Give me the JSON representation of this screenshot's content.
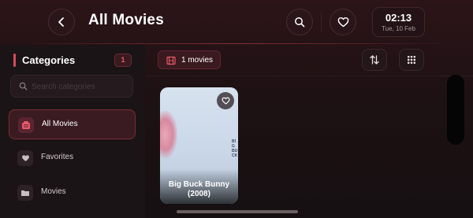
{
  "header": {
    "title": "All Movies",
    "time": "02:13",
    "date": "Tue, 10 Feb",
    "icons": {
      "back": "back-arrow-icon",
      "search": "search-icon",
      "favorite": "heart-icon"
    }
  },
  "sidebar": {
    "title": "Categories",
    "count": "1",
    "search_placeholder": "Search categories",
    "items": [
      {
        "label": "All Movies",
        "icon": "all-movies-icon",
        "active": true
      },
      {
        "label": "Favorites",
        "icon": "heart-icon",
        "active": false
      },
      {
        "label": "Movies",
        "icon": "folder-icon",
        "active": false
      }
    ]
  },
  "main": {
    "count_label": "1 movies",
    "movies": [
      {
        "title": "Big Buck Bunny (2008)",
        "poster_text": "BIG BUCK"
      }
    ]
  },
  "colors": {
    "accent": "#d84a5a",
    "background": "#1a1012",
    "sidebar": "#1b1416"
  }
}
